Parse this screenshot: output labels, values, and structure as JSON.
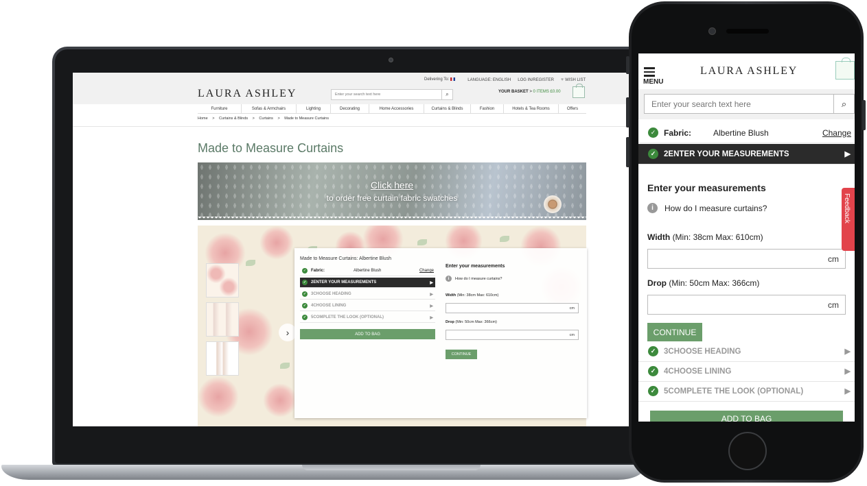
{
  "desktop": {
    "top_links": {
      "delivering_to": "Delivering To:",
      "language": "LANGUAGE: ENGLISH",
      "login": "LOG IN/REGISTER",
      "wishlist": "WISH LIST"
    },
    "logo": "LAURA ASHLEY",
    "search": {
      "placeholder": "Enter your search text here"
    },
    "basket": {
      "label": "YOUR BASKET",
      "sep": ">",
      "items": "0 ITEMS £0.00"
    },
    "nav": [
      "Furniture",
      "Sofas & Armchairs",
      "Lighting",
      "Decorating",
      "Home Accessories",
      "Curtains & Blinds",
      "Fashion",
      "Hotels & Tea Rooms",
      "Offers"
    ],
    "breadcrumbs": [
      "Home",
      "Curtains & Blinds",
      "Curtains",
      "Made to Measure Curtains"
    ],
    "breadcrumb_sep": ">",
    "page_title": "Made to Measure Curtains",
    "banner": {
      "link": "Click here",
      "sub": "to order free curtain fabric swatches"
    },
    "configurator": {
      "title": "Made to Measure Curtains: Albertine Blush",
      "fabric_label": "Fabric:",
      "fabric_value": "Albertine Blush",
      "change": "Change",
      "steps": [
        "2ENTER YOUR MEASUREMENTS",
        "3CHOOSE HEADING",
        "4CHOOSE LINING",
        "5COMPLETE THE LOOK (OPTIONAL)"
      ],
      "add_to_bag": "ADD TO BAG",
      "measurements_title": "Enter your measurements",
      "how_to": "How do I measure curtains?",
      "width_label": "Width",
      "width_range": "(Min: 38cm Max: 610cm)",
      "drop_label": "Drop",
      "drop_range": "(Min: 50cm Max: 366cm)",
      "unit": "cm",
      "continue": "CONTINUE"
    }
  },
  "mobile": {
    "menu_label": "MENU",
    "logo": "LAURA ASHLEY",
    "search": {
      "placeholder": "Enter your search text here"
    },
    "fabric_label": "Fabric:",
    "fabric_value": "Albertine Blush",
    "change": "Change",
    "steps": [
      "2ENTER YOUR MEASUREMENTS",
      "3CHOOSE HEADING",
      "4CHOOSE LINING",
      "5COMPLETE THE LOOK (OPTIONAL)"
    ],
    "measurements_title": "Enter your measurements",
    "how_to": "How do I measure curtains?",
    "width_label": "Width",
    "width_range": "(Min: 38cm Max: 610cm)",
    "drop_label": "Drop",
    "drop_range": "(Min: 50cm Max: 366cm)",
    "unit": "cm",
    "continue": "CONTINUE",
    "add_to_bag": "ADD TO BAG",
    "feedback": "Feedback"
  },
  "icons": {
    "check": "✓",
    "arrow": "▶",
    "chevron": "›",
    "info": "i",
    "search": "⌕",
    "heart": "♥"
  },
  "colors": {
    "brand_green": "#6b9e6b",
    "check_green": "#3c8a3c",
    "title_green": "#5b7a67",
    "active_step": "#2b2b2b",
    "feedback_red": "#e2434b"
  }
}
